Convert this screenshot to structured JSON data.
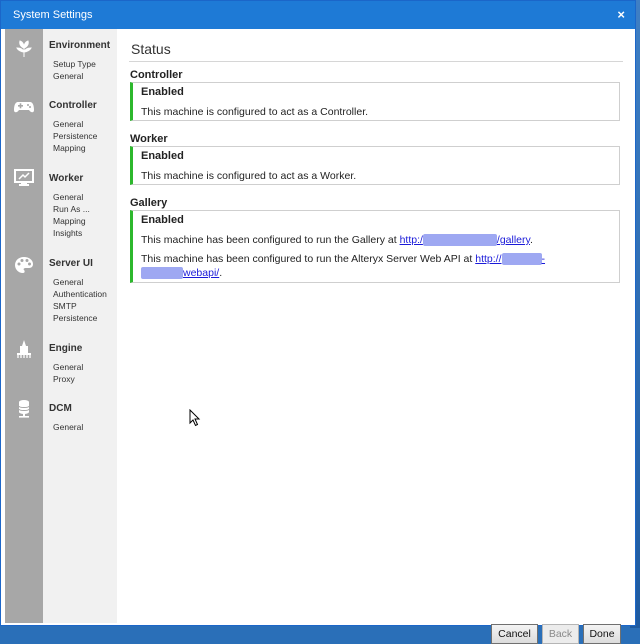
{
  "window": {
    "title": "System Settings",
    "close_glyph": "×"
  },
  "rail_icons": [
    "leaf-icon",
    "gamepad-icon",
    "monitor-icon",
    "palette-icon",
    "engine-icon",
    "database-icon"
  ],
  "nav": {
    "environment": {
      "label": "Environment",
      "items": [
        "Setup Type",
        "General"
      ]
    },
    "controller": {
      "label": "Controller",
      "items": [
        "General",
        "Persistence",
        "Mapping"
      ]
    },
    "worker": {
      "label": "Worker",
      "items": [
        "General",
        "Run As ...",
        "Mapping",
        "Insights"
      ]
    },
    "server_ui": {
      "label": "Server UI",
      "items": [
        "General",
        "Authentication",
        "SMTP",
        "Persistence"
      ]
    },
    "engine": {
      "label": "Engine",
      "items": [
        "General",
        "Proxy"
      ]
    },
    "dcm": {
      "label": "DCM",
      "items": [
        "General"
      ]
    }
  },
  "main": {
    "title": "Status",
    "controller": {
      "label": "Controller",
      "state": "Enabled",
      "text": "This machine is configured to act as a Controller."
    },
    "worker": {
      "label": "Worker",
      "state": "Enabled",
      "text": "This machine is configured to act as a Worker."
    },
    "gallery": {
      "label": "Gallery",
      "state": "Enabled",
      "line1_prefix": "This machine has been configured to run the Gallery at ",
      "line1_link_start": "http:/",
      "line1_link_end": "/gallery",
      "line1_suffix": ".",
      "line2_prefix": "This machine has been configured to run the Alteryx Server Web API at ",
      "line2_link_start": "http://",
      "line2_link_mid": "-",
      "line2_link_end": "webapi/",
      "line2_suffix": "."
    }
  },
  "buttons": {
    "cancel": "Cancel",
    "back": "Back",
    "done": "Done"
  },
  "colors": {
    "titlebar": "#1e7ad6",
    "accent_green": "#2db82d",
    "link": "#1a1ad9",
    "rail": "#a7a7a7"
  }
}
